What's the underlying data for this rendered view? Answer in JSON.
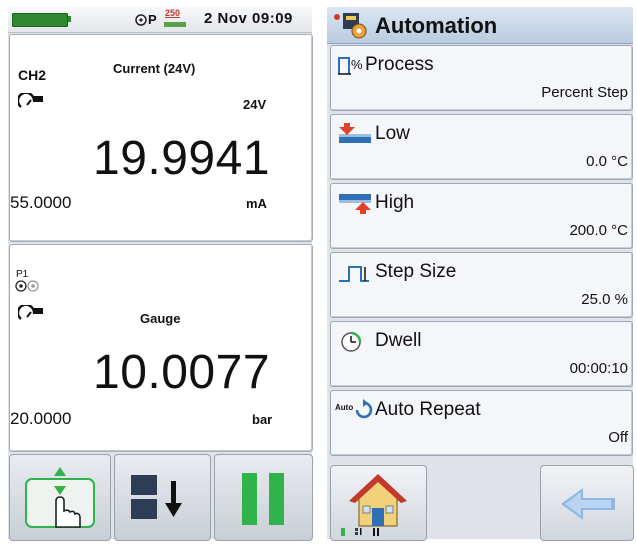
{
  "status_bar": {
    "date_time": "2 Nov  09:09",
    "pressure_indicator": "P",
    "pressure_badge": "250",
    "icons": [
      "battery-icon",
      "pressure-module-icon"
    ]
  },
  "channel1": {
    "name": "CH2",
    "function": "Current (24V)",
    "range": "24V",
    "value": "19.9941",
    "secondary_value": "55.0000",
    "unit": "mA"
  },
  "channel2": {
    "name": "P1",
    "function": "Gauge",
    "value": "10.0077",
    "secondary_value": "20.0000",
    "unit": "bar"
  },
  "bottom_buttons": [
    "up-down-touch-icon",
    "task-split-icon",
    "pause-icon"
  ],
  "automation": {
    "title": "Automation",
    "items": [
      {
        "label": "Process",
        "value": "Percent Step",
        "icon": "process-percent-icon"
      },
      {
        "label": "Low",
        "value": "0.0 °C",
        "icon": "low-limit-icon"
      },
      {
        "label": "High",
        "value": "200.0 °C",
        "icon": "high-limit-icon"
      },
      {
        "label": "Step Size",
        "value": "25.0 %",
        "icon": "step-size-icon"
      },
      {
        "label": "Dwell",
        "value": "00:00:10",
        "icon": "dwell-timer-icon"
      },
      {
        "label": "Auto Repeat",
        "value": "Off",
        "icon": "auto-repeat-icon"
      }
    ],
    "auto_badge": "Auto",
    "percent_symbol": "%"
  },
  "colors": {
    "accent_green": "#2fb34a",
    "accent_blue": "#2f6fb5",
    "title_bar": "#c7d6e8"
  }
}
